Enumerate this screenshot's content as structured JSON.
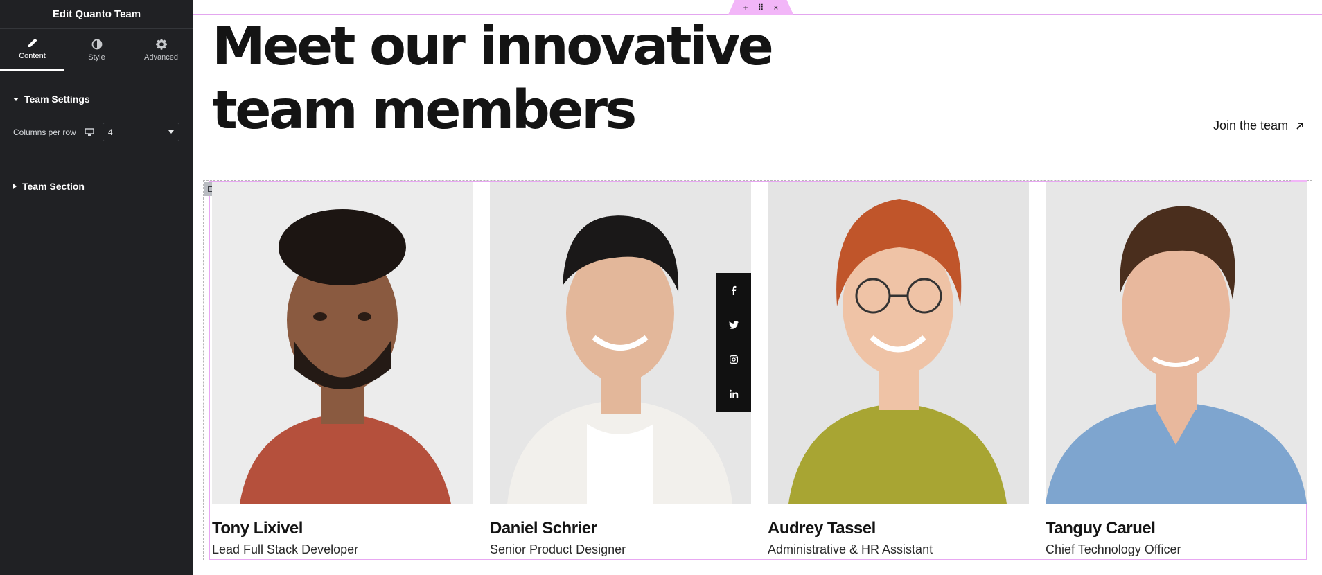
{
  "editor": {
    "title": "Edit Quanto Team",
    "tabs": [
      {
        "label": "Content",
        "icon": "pencil-icon",
        "active": true
      },
      {
        "label": "Style",
        "icon": "half-circle-icon",
        "active": false
      },
      {
        "label": "Advanced",
        "icon": "gear-icon",
        "active": false
      }
    ],
    "sections": {
      "team_settings": "Team Settings",
      "team_section": "Team Section"
    },
    "columns_control": {
      "label": "Columns per row",
      "device_icon": "desktop-icon",
      "value": "4"
    },
    "accent_color": "#f2b6f8"
  },
  "section_toolbar": {
    "add": "+",
    "move": "⠿",
    "close": "×"
  },
  "page": {
    "headline_line1": "Meet our innovative",
    "headline_line2": "team members",
    "join_link": "Join the team"
  },
  "team": [
    {
      "name": "Tony Lixivel",
      "role": "Lead Full Stack Developer",
      "shirt": "#b5503c",
      "skin": "#8a5a40",
      "hair": "#1c1512"
    },
    {
      "name": "Daniel Schrier",
      "role": "Senior Product Designer",
      "shirt": "#f2f0ec",
      "skin": "#e3b79a",
      "hair": "#1a1818"
    },
    {
      "name": "Audrey Tassel",
      "role": "Administrative & HR Assistant",
      "shirt": "#a8a533",
      "skin": "#efc3a6",
      "hair": "#c0552a"
    },
    {
      "name": "Tanguy Caruel",
      "role": "Chief Technology Officer",
      "shirt": "#7ea5cf",
      "skin": "#e8b89d",
      "hair": "#4a2e1d"
    }
  ],
  "social": [
    "facebook-icon",
    "twitter-icon",
    "instagram-icon",
    "linkedin-icon"
  ]
}
